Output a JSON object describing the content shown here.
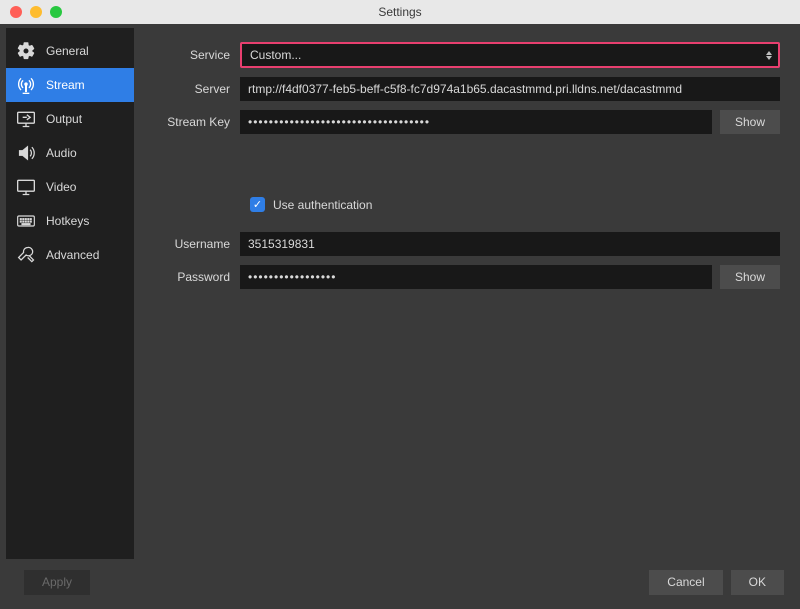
{
  "window": {
    "title": "Settings"
  },
  "sidebar": {
    "items": [
      {
        "label": "General"
      },
      {
        "label": "Stream"
      },
      {
        "label": "Output"
      },
      {
        "label": "Audio"
      },
      {
        "label": "Video"
      },
      {
        "label": "Hotkeys"
      },
      {
        "label": "Advanced"
      }
    ],
    "active_index": 1
  },
  "form": {
    "service_label": "Service",
    "service_value": "Custom...",
    "server_label": "Server",
    "server_value": "rtmp://f4df0377-feb5-beff-c5f8-fc7d974a1b65.dacastmmd.pri.lldns.net/dacastmmd",
    "streamkey_label": "Stream Key",
    "streamkey_value": "•••••••••••••••••••••••••••••••••••",
    "show_button": "Show",
    "use_auth_label": "Use authentication",
    "use_auth_checked": true,
    "username_label": "Username",
    "username_value": "3515319831",
    "password_label": "Password",
    "password_value": "•••••••••••••••••"
  },
  "footer": {
    "apply": "Apply",
    "cancel": "Cancel",
    "ok": "OK"
  }
}
